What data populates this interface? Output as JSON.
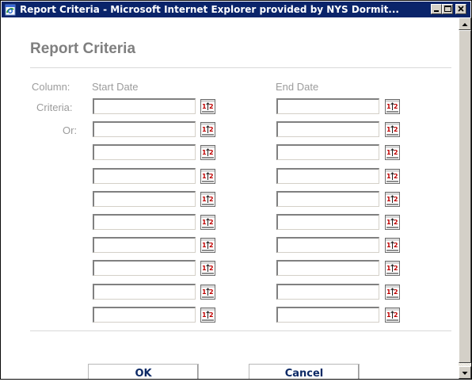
{
  "window": {
    "title": "Report Criteria - Microsoft Internet Explorer provided by NYS Dormit...",
    "icon": "ie-page-icon"
  },
  "page": {
    "heading": "Report Criteria"
  },
  "labels": {
    "column": "Column:",
    "criteria": "Criteria:",
    "or": "Or:",
    "start_date": "Start Date",
    "end_date": "End Date"
  },
  "criteria_rows": [
    {
      "start": "",
      "end": ""
    },
    {
      "start": "",
      "end": ""
    },
    {
      "start": "",
      "end": ""
    },
    {
      "start": "",
      "end": ""
    },
    {
      "start": "",
      "end": ""
    },
    {
      "start": "",
      "end": ""
    },
    {
      "start": "",
      "end": ""
    },
    {
      "start": "",
      "end": ""
    },
    {
      "start": "",
      "end": ""
    },
    {
      "start": "",
      "end": ""
    }
  ],
  "picker_icon": "calendar-picker-icon",
  "buttons": {
    "ok": "OK",
    "cancel": "Cancel"
  },
  "colors": {
    "titlebar": "#0a246a",
    "label": "#9c9c9c",
    "button_text": "#0d2a66"
  }
}
